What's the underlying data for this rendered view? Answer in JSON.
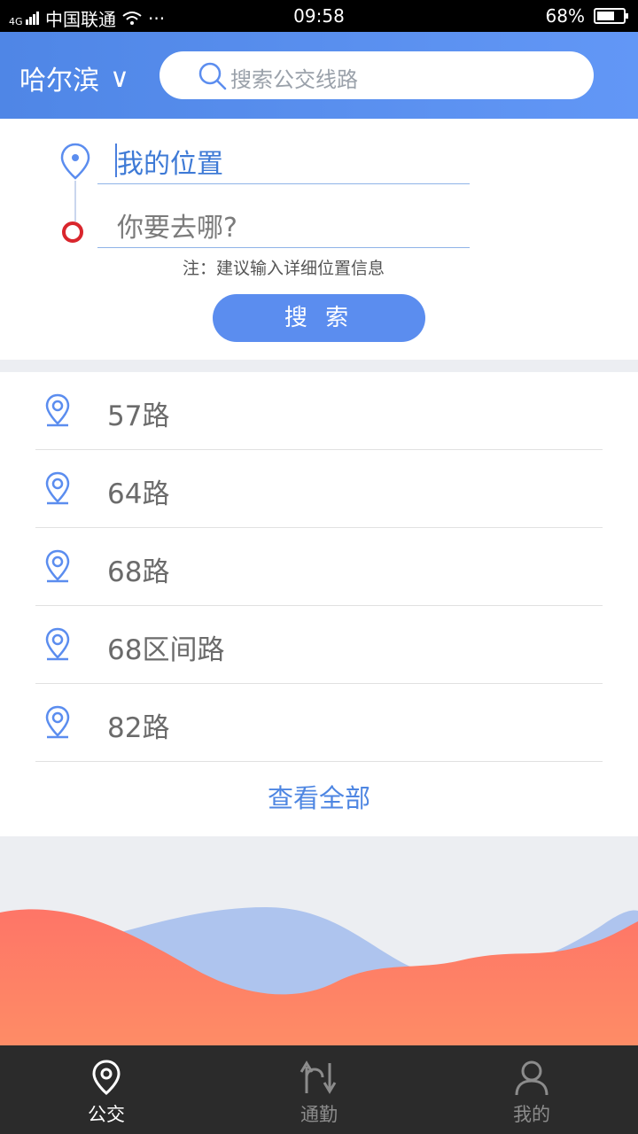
{
  "status_bar": {
    "network": "4G",
    "carrier": "中国联通",
    "dots": "···",
    "time": "09:58",
    "battery": "68%",
    "battery_level": 0.68
  },
  "header": {
    "city": "哈尔滨",
    "city_chevron": "∨",
    "search_placeholder": "搜索公交线路",
    "search_icon": "search-icon"
  },
  "route": {
    "origin": "我的位置",
    "destination_placeholder": "你要去哪?",
    "note": "注：建议输入详细位置信息",
    "search_button": "搜 索"
  },
  "lines": [
    {
      "label": "57路"
    },
    {
      "label": "64路"
    },
    {
      "label": "68路"
    },
    {
      "label": "68区间路"
    },
    {
      "label": "82路"
    }
  ],
  "view_all": "查看全部",
  "tabs": [
    {
      "label": "公交",
      "icon": "location-pin-icon",
      "active": true
    },
    {
      "label": "通勤",
      "icon": "route-arrows-icon",
      "active": false
    },
    {
      "label": "我的",
      "icon": "user-icon",
      "active": false
    }
  ],
  "colors": {
    "primary": "#5b8def",
    "header_start": "#4f86e6",
    "header_end": "#6297f6",
    "destination_ring": "#d9262d",
    "wave_blue": "#aec4ee",
    "wave_orange": "#fe7d68",
    "tabbar": "#2b2b2b"
  }
}
